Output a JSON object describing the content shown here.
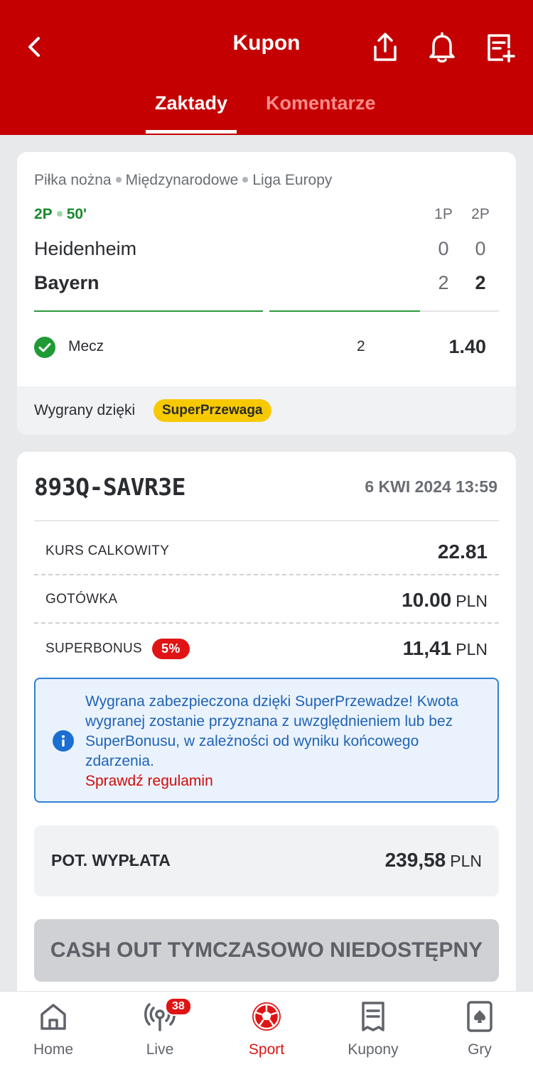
{
  "header": {
    "title": "Kupon",
    "tabs": [
      {
        "label": "Zaktady",
        "active": true
      },
      {
        "label": "Komentarze",
        "active": false
      }
    ],
    "icons": [
      "back-icon",
      "share-icon",
      "bell-icon",
      "note-add-icon"
    ],
    "bg_color": "#c40000"
  },
  "event": {
    "breadcrumb": [
      "Piłka nożna",
      "Międzynarodowe",
      "Liga Europy"
    ],
    "period": "2P",
    "minute": "50'",
    "col_headers": [
      "1P",
      "2P"
    ],
    "home": {
      "name": "Heidenheim",
      "scores": [
        "0",
        "0"
      ]
    },
    "away": {
      "name": "Bayern",
      "scores": [
        "2",
        "2"
      ]
    },
    "bet": {
      "market": "Mecz",
      "pick": "2",
      "odds": "1.40",
      "status": "won"
    },
    "win_label": "Wygrany dzięki",
    "win_badge": "SuperPrzewaga"
  },
  "coupon": {
    "id": "893Q-SAVR3E",
    "date": "6 KWI 2024 13:59",
    "rows": [
      {
        "label": "KURS CALKOWITY",
        "value": "22.81",
        "currency": ""
      },
      {
        "label": "GOTÓWKA",
        "value": "10.00",
        "currency": "PLN"
      },
      {
        "label": "SUPERBONUS",
        "badge": "5%",
        "value": "11,41",
        "currency": "PLN"
      }
    ],
    "info": {
      "text": "Wygrana zabezpieczona dzięki SuperPrzewadze! Kwota wygranej zostanie przyznana z uwzględnieniem lub bez SuperBonusu, w zależności od wyniku końcowego zdarzenia.",
      "link": "Sprawdź regulamin"
    },
    "payout": {
      "label": "POT. WYPŁATA",
      "value": "239,58",
      "currency": "PLN"
    },
    "cashout_label": "CASH OUT TYMCZASOWO NIEDOSTĘPNY"
  },
  "nav": {
    "items": [
      {
        "label": "Home",
        "icon": "home-icon"
      },
      {
        "label": "Live",
        "icon": "live-icon",
        "badge": "38"
      },
      {
        "label": "Sport",
        "icon": "soccer-ball-icon",
        "active": true
      },
      {
        "label": "Kupony",
        "icon": "receipt-icon"
      },
      {
        "label": "Gry",
        "icon": "cards-icon"
      }
    ],
    "active_color": "#e01414"
  }
}
